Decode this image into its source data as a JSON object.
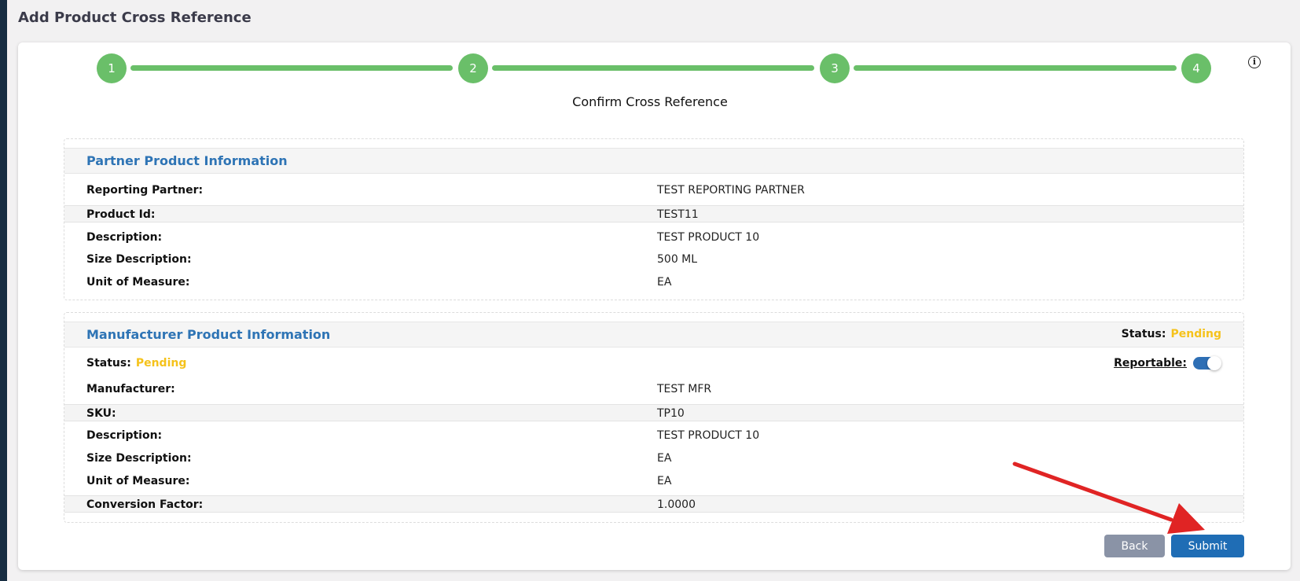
{
  "page": {
    "title": "Add Product Cross Reference"
  },
  "stepper": {
    "steps": [
      "1",
      "2",
      "3",
      "4"
    ],
    "heading": "Confirm Cross Reference",
    "colors": {
      "step": "#6abf69"
    }
  },
  "partner": {
    "title": "Partner Product Information",
    "rows": [
      {
        "label": "Reporting Partner:",
        "value": "TEST REPORTING PARTNER"
      },
      {
        "label": "Product Id:",
        "value": "TEST11"
      },
      {
        "label": "Description:",
        "value": "TEST PRODUCT 10"
      },
      {
        "label": "Size Description:",
        "value": "500 ML"
      },
      {
        "label": "Unit of Measure:",
        "value": "EA"
      }
    ]
  },
  "manufacturer": {
    "title": "Manufacturer Product Information",
    "header_status": {
      "label": "Status:",
      "value": "Pending"
    },
    "row_status": {
      "label": "Status:",
      "value": "Pending"
    },
    "reportable": {
      "label": "Reportable:",
      "enabled": true
    },
    "rows": [
      {
        "label": "Manufacturer:",
        "value": "TEST MFR"
      },
      {
        "label": "SKU:",
        "value": "TP10"
      },
      {
        "label": "Description:",
        "value": "TEST PRODUCT 10"
      },
      {
        "label": "Size Description:",
        "value": "EA"
      },
      {
        "label": "Unit of Measure:",
        "value": "EA"
      },
      {
        "label": "Conversion Factor:",
        "value": "1.0000"
      }
    ]
  },
  "buttons": {
    "back": "Back",
    "submit": "Submit"
  },
  "colors": {
    "accent": "#2e74b5",
    "pending": "#f5c21b",
    "annotation_arrow": "#e02424"
  }
}
